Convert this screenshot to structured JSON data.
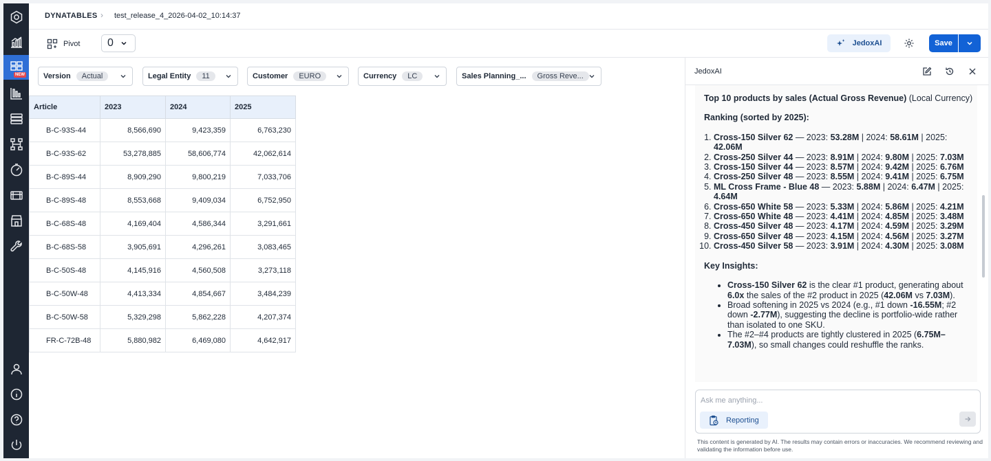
{
  "breadcrumb": {
    "root": "DYNATABLES",
    "leaf": "test_release_4_2026-04-02_10:14:37"
  },
  "toolbar": {
    "pivot_label": "Pivot",
    "view_value": "0",
    "ai_label": "JedoxAI",
    "save_label": "Save"
  },
  "rail": {
    "new_tag": "NEW"
  },
  "filters": [
    {
      "label": "Version",
      "value": "Actual"
    },
    {
      "label": "Legal Entity",
      "value": "11"
    },
    {
      "label": "Customer",
      "value": "EURO"
    },
    {
      "label": "Currency",
      "value": "LC"
    },
    {
      "label": "Sales Planning_...",
      "value": "Gross Reve..."
    }
  ],
  "table": {
    "headers": [
      "Article",
      "2023",
      "2024",
      "2025"
    ],
    "rows": [
      [
        "B-C-93S-44",
        "8,566,690",
        "9,423,359",
        "6,763,230"
      ],
      [
        "B-C-93S-62",
        "53,278,885",
        "58,606,774",
        "42,062,614"
      ],
      [
        "B-C-89S-44",
        "8,909,290",
        "9,800,219",
        "7,033,706"
      ],
      [
        "B-C-89S-48",
        "8,553,668",
        "9,409,034",
        "6,752,950"
      ],
      [
        "B-C-68S-48",
        "4,169,404",
        "4,586,344",
        "3,291,661"
      ],
      [
        "B-C-68S-58",
        "3,905,691",
        "4,296,261",
        "3,083,465"
      ],
      [
        "B-C-50S-48",
        "4,145,916",
        "4,560,508",
        "3,273,118"
      ],
      [
        "B-C-50W-48",
        "4,413,334",
        "4,854,667",
        "3,484,239"
      ],
      [
        "B-C-50W-58",
        "5,329,298",
        "5,862,228",
        "4,207,374"
      ],
      [
        "FR-C-72B-48",
        "5,880,982",
        "6,469,080",
        "4,642,917"
      ]
    ]
  },
  "ai": {
    "panel_title": "JedoxAI",
    "heading_bold": "Top 10 products by sales (Actual Gross Revenue)",
    "heading_rest": " (Local Currency)",
    "ranking_title": "Ranking (sorted by 2025):",
    "ranking": [
      {
        "name": "Cross-150 Silver 62",
        "y2023": "53.28M",
        "y2024": "58.61M",
        "y2025": "42.06M"
      },
      {
        "name": "Cross-250 Silver 44",
        "y2023": "8.91M",
        "y2024": "9.80M",
        "y2025": "7.03M"
      },
      {
        "name": "Cross-150 Silver 44",
        "y2023": "8.57M",
        "y2024": "9.42M",
        "y2025": "6.76M"
      },
      {
        "name": "Cross-250 Silver 48",
        "y2023": "8.55M",
        "y2024": "9.41M",
        "y2025": "6.75M"
      },
      {
        "name": "ML Cross Frame - Blue 48",
        "y2023": "5.88M",
        "y2024": "6.47M",
        "y2025": "4.64M"
      },
      {
        "name": "Cross-650 White 58",
        "y2023": "5.33M",
        "y2024": "5.86M",
        "y2025": "4.21M"
      },
      {
        "name": "Cross-650 White 48",
        "y2023": "4.41M",
        "y2024": "4.85M",
        "y2025": "3.48M"
      },
      {
        "name": "Cross-450 Silver 48",
        "y2023": "4.17M",
        "y2024": "4.59M",
        "y2025": "3.29M"
      },
      {
        "name": "Cross-650 Silver 48",
        "y2023": "4.15M",
        "y2024": "4.56M",
        "y2025": "3.27M"
      },
      {
        "name": "Cross-450 Silver 58",
        "y2023": "3.91M",
        "y2024": "4.30M",
        "y2025": "3.08M"
      }
    ],
    "insights_title": "Key Insights:",
    "insight1": {
      "b1": "Cross-150 Silver 62",
      "t1": " is the clear #1 product, generating about ",
      "b2": "6.0x",
      "t2": " the sales of the #2 product in 2025 (",
      "b3": "42.06M",
      "t3": " vs ",
      "b4": "7.03M",
      "t4": ")."
    },
    "insight2": {
      "t1": "Broad softening in 2025 vs 2024 (e.g., #1 down ",
      "b1": "-16.55M",
      "t2": "; #2 down ",
      "b2": "-2.77M",
      "t3": "), suggesting the decline is portfolio-wide rather than isolated to one SKU."
    },
    "insight3": {
      "t1": "The #2–#4 products are tightly clustered in 2025 (",
      "b1": "6.75M–7.03M",
      "t2": "), so small changes could reshuffle the ranks."
    },
    "ask_placeholder": "Ask me anything...",
    "reporting_label": "Reporting",
    "disclaimer": "This content is generated by AI. The results may contain errors or inaccuracies. We recommend reviewing and validating the information before use."
  }
}
